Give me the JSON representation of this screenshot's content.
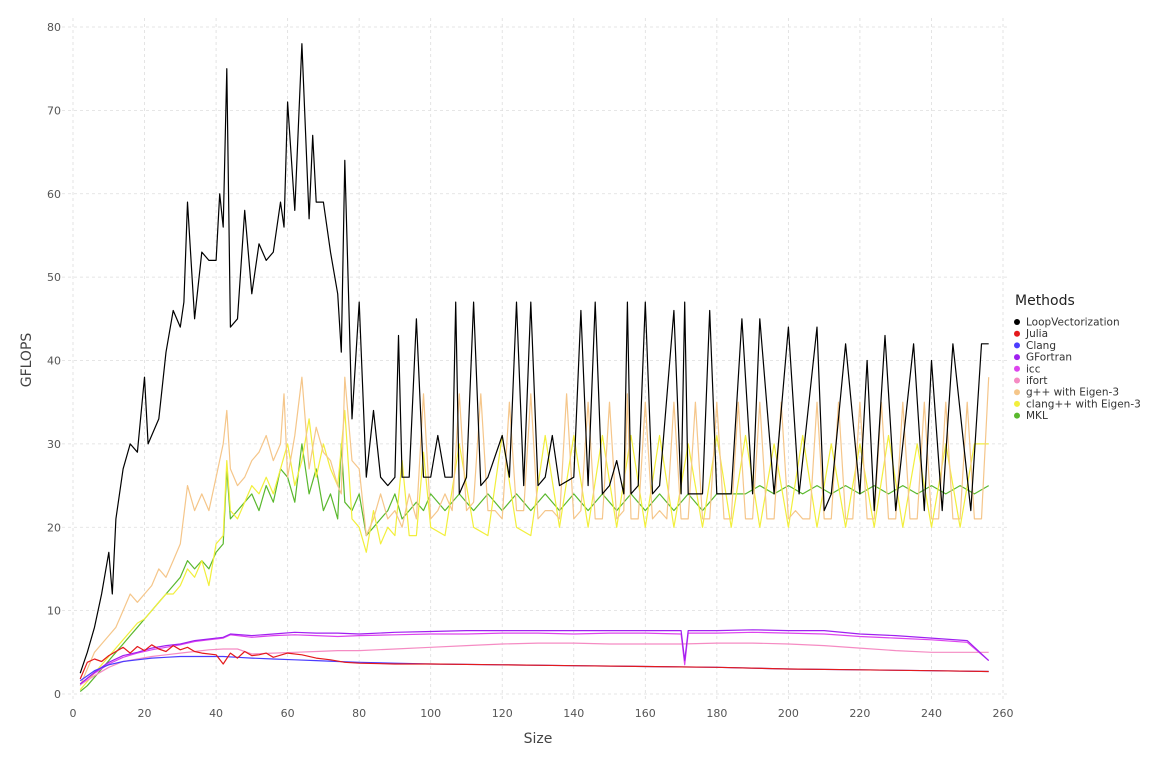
{
  "chart_data": {
    "type": "line",
    "xlabel": "Size",
    "ylabel": "GFLOPS",
    "xlim": [
      0,
      260
    ],
    "ylim": [
      0,
      80
    ],
    "x_ticks": [
      0,
      20,
      40,
      60,
      80,
      100,
      120,
      140,
      160,
      180,
      200,
      220,
      240,
      260
    ],
    "y_ticks": [
      0,
      10,
      20,
      30,
      40,
      50,
      60,
      70,
      80
    ],
    "grid": true,
    "legend": {
      "title": "Methods",
      "position": "right"
    },
    "series": [
      {
        "name": "LoopVectorization",
        "color": "#000000",
        "x": [
          2,
          4,
          6,
          8,
          10,
          11,
          12,
          14,
          16,
          18,
          20,
          21,
          24,
          26,
          28,
          30,
          31,
          32,
          34,
          36,
          38,
          40,
          41,
          42,
          43,
          44,
          46,
          48,
          50,
          52,
          54,
          56,
          58,
          59,
          60,
          62,
          64,
          66,
          67,
          68,
          70,
          72,
          74,
          75,
          76,
          78,
          80,
          82,
          84,
          86,
          88,
          90,
          91,
          92,
          94,
          96,
          98,
          100,
          102,
          104,
          106,
          107,
          108,
          110,
          112,
          114,
          116,
          120,
          122,
          124,
          126,
          128,
          130,
          132,
          134,
          136,
          140,
          142,
          144,
          146,
          148,
          150,
          152,
          154,
          155,
          156,
          158,
          160,
          162,
          164,
          168,
          170,
          171,
          172,
          176,
          178,
          180,
          184,
          187,
          190,
          192,
          196,
          200,
          203,
          208,
          210,
          212,
          216,
          220,
          222,
          224,
          227,
          230,
          235,
          238,
          240,
          243,
          246,
          251,
          254,
          256
        ],
        "y": [
          2.5,
          5,
          8,
          12,
          17,
          12,
          21,
          27,
          30,
          29,
          38,
          30,
          33,
          41,
          46,
          44,
          47,
          59,
          45,
          53,
          52,
          52,
          60,
          56,
          75,
          44,
          45,
          58,
          48,
          54,
          52,
          53,
          59,
          56,
          71,
          58,
          78,
          57,
          67,
          59,
          59,
          53,
          48,
          41,
          64,
          33,
          47,
          26,
          34,
          26,
          25,
          26,
          43,
          26,
          26,
          45,
          26,
          26,
          31,
          26,
          26,
          47,
          24,
          26,
          47,
          25,
          26,
          31,
          26,
          47,
          25,
          47,
          25,
          26,
          31,
          25,
          26,
          46,
          25,
          47,
          24,
          25,
          28,
          24,
          47,
          24,
          25,
          47,
          24,
          25,
          46,
          24,
          47,
          24,
          24,
          46,
          24,
          24,
          45,
          24,
          45,
          24,
          44,
          24,
          44,
          22,
          24,
          42,
          24,
          40,
          22,
          43,
          22,
          42,
          22,
          40,
          22,
          42,
          22,
          42,
          42
        ]
      },
      {
        "name": "Julia",
        "color": "#e41a1c",
        "x": [
          2,
          4,
          6,
          8,
          10,
          12,
          14,
          16,
          18,
          20,
          22,
          24,
          26,
          28,
          30,
          32,
          34,
          36,
          40,
          42,
          44,
          46,
          48,
          50,
          52,
          54,
          56,
          60,
          64,
          68,
          72,
          76,
          80,
          90,
          100,
          120,
          140,
          160,
          180,
          200,
          220,
          240,
          256
        ],
        "y": [
          1.8,
          3.8,
          4.2,
          3.9,
          4.6,
          5.1,
          5.6,
          4.9,
          5.7,
          5.2,
          5.9,
          5.4,
          5.1,
          5.8,
          5.3,
          5.6,
          5.1,
          4.9,
          4.7,
          3.6,
          4.9,
          4.3,
          5.1,
          4.6,
          4.7,
          4.9,
          4.4,
          4.9,
          4.7,
          4.3,
          4.1,
          3.8,
          3.7,
          3.6,
          3.6,
          3.5,
          3.4,
          3.3,
          3.2,
          3.0,
          2.9,
          2.8,
          2.7
        ]
      },
      {
        "name": "Clang",
        "color": "#4b3cff",
        "x": [
          2,
          6,
          10,
          14,
          18,
          22,
          26,
          30,
          34,
          38,
          42,
          46,
          50,
          56,
          62,
          68,
          74,
          80,
          90,
          100,
          120,
          140,
          160,
          180,
          200,
          220,
          240,
          256
        ],
        "y": [
          1.6,
          2.8,
          3.5,
          3.9,
          4.1,
          4.3,
          4.4,
          4.5,
          4.5,
          4.5,
          4.5,
          4.4,
          4.3,
          4.2,
          4.1,
          4.0,
          3.9,
          3.8,
          3.7,
          3.6,
          3.5,
          3.4,
          3.3,
          3.2,
          3.0,
          2.9,
          2.8,
          2.7
        ]
      },
      {
        "name": "GFortran",
        "color": "#a020f0",
        "x": [
          2,
          6,
          10,
          14,
          18,
          22,
          26,
          30,
          34,
          38,
          42,
          44,
          50,
          56,
          62,
          68,
          74,
          80,
          90,
          100,
          110,
          120,
          130,
          140,
          150,
          160,
          170,
          171,
          172,
          180,
          190,
          200,
          210,
          220,
          230,
          240,
          250,
          256
        ],
        "y": [
          1.2,
          2.6,
          3.8,
          4.6,
          5.0,
          5.5,
          5.8,
          6.0,
          6.4,
          6.6,
          6.8,
          7.2,
          7.0,
          7.2,
          7.4,
          7.3,
          7.3,
          7.2,
          7.4,
          7.5,
          7.6,
          7.6,
          7.6,
          7.6,
          7.6,
          7.6,
          7.6,
          4.0,
          7.6,
          7.6,
          7.7,
          7.6,
          7.6,
          7.2,
          7.0,
          6.7,
          6.4,
          4.0
        ]
      },
      {
        "name": "icc",
        "color": "#dd44ee",
        "x": [
          2,
          6,
          10,
          14,
          18,
          22,
          26,
          30,
          34,
          38,
          42,
          44,
          50,
          56,
          62,
          68,
          74,
          80,
          90,
          100,
          110,
          120,
          130,
          140,
          150,
          160,
          170,
          171,
          172,
          180,
          190,
          200,
          210,
          220,
          230,
          240,
          250,
          256
        ],
        "y": [
          1.2,
          2.5,
          3.6,
          4.4,
          4.9,
          5.3,
          5.6,
          5.9,
          6.3,
          6.5,
          6.7,
          7.1,
          6.8,
          7.0,
          7.1,
          7.0,
          6.9,
          7.0,
          7.1,
          7.2,
          7.2,
          7.3,
          7.3,
          7.2,
          7.3,
          7.3,
          7.2,
          3.5,
          7.3,
          7.3,
          7.4,
          7.3,
          7.2,
          6.9,
          6.7,
          6.5,
          6.2,
          4.0
        ]
      },
      {
        "name": "ifort",
        "color": "#f58bc3",
        "x": [
          2,
          6,
          10,
          14,
          18,
          22,
          26,
          30,
          34,
          38,
          42,
          46,
          50,
          56,
          62,
          68,
          74,
          80,
          90,
          100,
          110,
          120,
          130,
          140,
          150,
          160,
          170,
          180,
          190,
          200,
          210,
          220,
          230,
          240,
          250,
          256
        ],
        "y": [
          1.1,
          2.2,
          3.2,
          3.9,
          4.2,
          4.5,
          4.7,
          4.9,
          5.1,
          5.3,
          5.4,
          5.4,
          4.8,
          4.9,
          5.0,
          5.1,
          5.2,
          5.2,
          5.4,
          5.6,
          5.8,
          6.0,
          6.1,
          6.1,
          6.0,
          6.0,
          6.0,
          6.1,
          6.1,
          6.0,
          5.8,
          5.5,
          5.2,
          5.0,
          5.0,
          5.0
        ]
      },
      {
        "name": "g++ with Eigen-3",
        "color": "#f5c68a",
        "x": [
          2,
          4,
          6,
          8,
          10,
          12,
          14,
          16,
          18,
          20,
          22,
          24,
          26,
          28,
          30,
          32,
          34,
          36,
          38,
          40,
          42,
          43,
          44,
          46,
          48,
          50,
          52,
          54,
          56,
          58,
          59,
          60,
          62,
          64,
          66,
          68,
          70,
          72,
          74,
          75,
          76,
          78,
          80,
          82,
          84,
          86,
          88,
          90,
          92,
          94,
          96,
          98,
          100,
          102,
          104,
          106,
          108,
          110,
          112,
          114,
          116,
          118,
          120,
          122,
          124,
          126,
          128,
          130,
          132,
          134,
          136,
          138,
          140,
          142,
          144,
          146,
          148,
          150,
          152,
          154,
          155,
          156,
          158,
          160,
          162,
          164,
          166,
          168,
          170,
          172,
          174,
          176,
          178,
          180,
          182,
          184,
          186,
          188,
          190,
          192,
          194,
          196,
          198,
          200,
          202,
          204,
          206,
          208,
          210,
          212,
          214,
          216,
          218,
          220,
          222,
          224,
          226,
          228,
          230,
          232,
          234,
          236,
          238,
          240,
          242,
          244,
          246,
          248,
          250,
          252,
          254,
          256
        ],
        "y": [
          1,
          3,
          5,
          6,
          7,
          8,
          10,
          12,
          11,
          12,
          13,
          15,
          14,
          16,
          18,
          25,
          22,
          24,
          22,
          26,
          30,
          34,
          27,
          25,
          26,
          28,
          29,
          31,
          28,
          30,
          36,
          26,
          31,
          38,
          27,
          32,
          29,
          28,
          25,
          24,
          38,
          28,
          27,
          19,
          21,
          24,
          21,
          22,
          20,
          24,
          21,
          36,
          21,
          22,
          24,
          22,
          36,
          22,
          23,
          36,
          22,
          22,
          21,
          35,
          22,
          22,
          36,
          21,
          22,
          22,
          21,
          36,
          21,
          22,
          35,
          21,
          21,
          35,
          21,
          22,
          36,
          21,
          21,
          35,
          21,
          22,
          21,
          35,
          21,
          21,
          35,
          21,
          21,
          35,
          21,
          21,
          35,
          21,
          21,
          35,
          21,
          21,
          35,
          21,
          22,
          21,
          21,
          35,
          21,
          21,
          35,
          21,
          21,
          35,
          21,
          21,
          35,
          21,
          21,
          35,
          21,
          21,
          35,
          21,
          21,
          35,
          21,
          21,
          35,
          21,
          21,
          38
        ]
      },
      {
        "name": "clang++ with Eigen-3",
        "color": "#f2ef3c",
        "x": [
          2,
          4,
          6,
          8,
          10,
          12,
          14,
          16,
          18,
          20,
          22,
          24,
          26,
          28,
          30,
          32,
          34,
          36,
          38,
          40,
          42,
          43,
          44,
          46,
          48,
          50,
          52,
          54,
          56,
          58,
          60,
          62,
          64,
          66,
          68,
          70,
          72,
          74,
          76,
          78,
          80,
          82,
          84,
          86,
          88,
          90,
          92,
          94,
          96,
          98,
          100,
          104,
          108,
          112,
          116,
          120,
          124,
          128,
          132,
          136,
          140,
          144,
          148,
          152,
          156,
          160,
          164,
          168,
          172,
          176,
          180,
          184,
          188,
          192,
          196,
          200,
          204,
          208,
          212,
          216,
          220,
          224,
          228,
          232,
          236,
          240,
          244,
          248,
          252,
          256
        ],
        "y": [
          0.5,
          1.5,
          2.5,
          3.5,
          4.5,
          5.5,
          6.5,
          7.5,
          8.5,
          9,
          10,
          11,
          12,
          12,
          13,
          15,
          14,
          16,
          13,
          18,
          19,
          28,
          22,
          21,
          23,
          25,
          24,
          26,
          24,
          27,
          30,
          25,
          28,
          33,
          26,
          30,
          27,
          25,
          34,
          21,
          20,
          17,
          22,
          18,
          20,
          19,
          28,
          19,
          19,
          29,
          20,
          19,
          30,
          20,
          19,
          31,
          20,
          19,
          31,
          20,
          31,
          20,
          31,
          20,
          31,
          20,
          31,
          20,
          30,
          20,
          31,
          20,
          31,
          20,
          30,
          20,
          31,
          20,
          30,
          20,
          30,
          20,
          31,
          20,
          30,
          20,
          30,
          20,
          30,
          30
        ]
      },
      {
        "name": "MKL",
        "color": "#5ab82e",
        "x": [
          2,
          4,
          6,
          8,
          10,
          12,
          14,
          16,
          18,
          20,
          22,
          24,
          26,
          28,
          30,
          32,
          34,
          36,
          38,
          40,
          42,
          43,
          44,
          46,
          48,
          50,
          52,
          54,
          56,
          58,
          60,
          62,
          64,
          66,
          68,
          70,
          72,
          74,
          75,
          76,
          78,
          80,
          82,
          84,
          86,
          88,
          90,
          92,
          94,
          96,
          98,
          100,
          104,
          108,
          112,
          116,
          120,
          124,
          128,
          132,
          136,
          140,
          144,
          148,
          152,
          156,
          160,
          164,
          168,
          172,
          176,
          180,
          184,
          188,
          192,
          196,
          200,
          204,
          208,
          212,
          216,
          220,
          224,
          228,
          232,
          236,
          240,
          244,
          248,
          252,
          256
        ],
        "y": [
          0.3,
          1,
          2,
          3,
          4,
          5,
          6,
          7,
          8,
          9,
          10,
          11,
          12,
          13,
          14,
          16,
          15,
          16,
          15,
          17,
          18,
          27,
          21,
          22,
          23,
          24,
          22,
          25,
          23,
          27,
          26,
          23,
          30,
          24,
          27,
          22,
          24,
          21,
          30,
          23,
          22,
          24,
          19,
          20,
          21,
          22,
          24,
          21,
          22,
          23,
          22,
          24,
          22,
          24,
          22,
          24,
          22,
          24,
          22,
          24,
          22,
          24,
          22,
          24,
          22,
          24,
          22,
          24,
          22,
          24,
          22,
          24,
          24,
          24,
          25,
          24,
          25,
          24,
          25,
          24,
          25,
          24,
          25,
          24,
          25,
          24,
          25,
          24,
          25,
          24,
          25
        ]
      }
    ]
  }
}
